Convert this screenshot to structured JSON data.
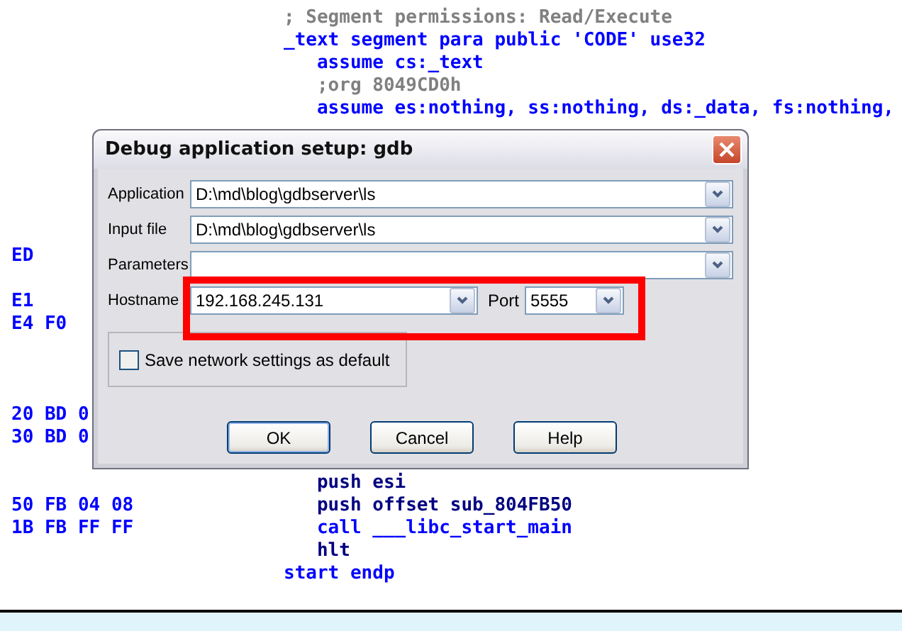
{
  "listing": {
    "top_lines": [
      {
        "code": "; Segment permissions: Read/Execute",
        "kind": "comment"
      },
      {
        "code": "_text segment para public 'CODE' use32",
        "kind": "directive"
      },
      {
        "code": "   assume cs:_text",
        "kind": "directive"
      },
      {
        "code": "   ;org 8049CD0h",
        "kind": "comment"
      },
      {
        "code": "   assume es:nothing, ss:nothing, ds:_data, fs:nothing,",
        "kind": "directive"
      }
    ],
    "lower_lines": [
      {
        "hex": "ED",
        "kind": "hex"
      },
      {
        "kind": "blank"
      },
      {
        "hex": "E1",
        "kind": "hex"
      },
      {
        "hex": "E4 F0",
        "kind": "hex"
      },
      {
        "kind": "blank"
      },
      {
        "kind": "blank"
      },
      {
        "kind": "blank"
      },
      {
        "hex": "20 BD 0",
        "kind": "hex"
      },
      {
        "hex": "30 BD 0",
        "kind": "hex"
      },
      {
        "kind": "blank"
      },
      {
        "code": "   push esi",
        "kind": "instruction"
      },
      {
        "hex": "50 FB 04 08",
        "code": "   push offset sub_804FB50",
        "kind": "instruction"
      },
      {
        "hex": "1B FB FF FF",
        "code": "   call ___libc_start_main",
        "kind": "directive"
      },
      {
        "code": "   hlt",
        "kind": "instruction"
      },
      {
        "code": "start endp",
        "kind": "directive"
      }
    ]
  },
  "dialog": {
    "title": "Debug application setup: gdb",
    "fields": [
      {
        "label": "Application",
        "value": "D:\\md\\blog\\gdbserver\\ls"
      },
      {
        "label": "Input file",
        "value": "D:\\md\\blog\\gdbserver\\ls"
      },
      {
        "label": "Parameters"
      }
    ],
    "hostname": {
      "label": "Hostname",
      "value": "192.168.245.131"
    },
    "port": {
      "label": "Port",
      "value": "5555"
    },
    "save_default": {
      "label": "Save network settings as default",
      "checked": false
    },
    "buttons": [
      {
        "label": "OK",
        "default": true
      },
      {
        "label": "Cancel",
        "default": false
      },
      {
        "label": "Help",
        "default": false
      }
    ]
  },
  "highlight": {
    "color": "#ff0000"
  }
}
